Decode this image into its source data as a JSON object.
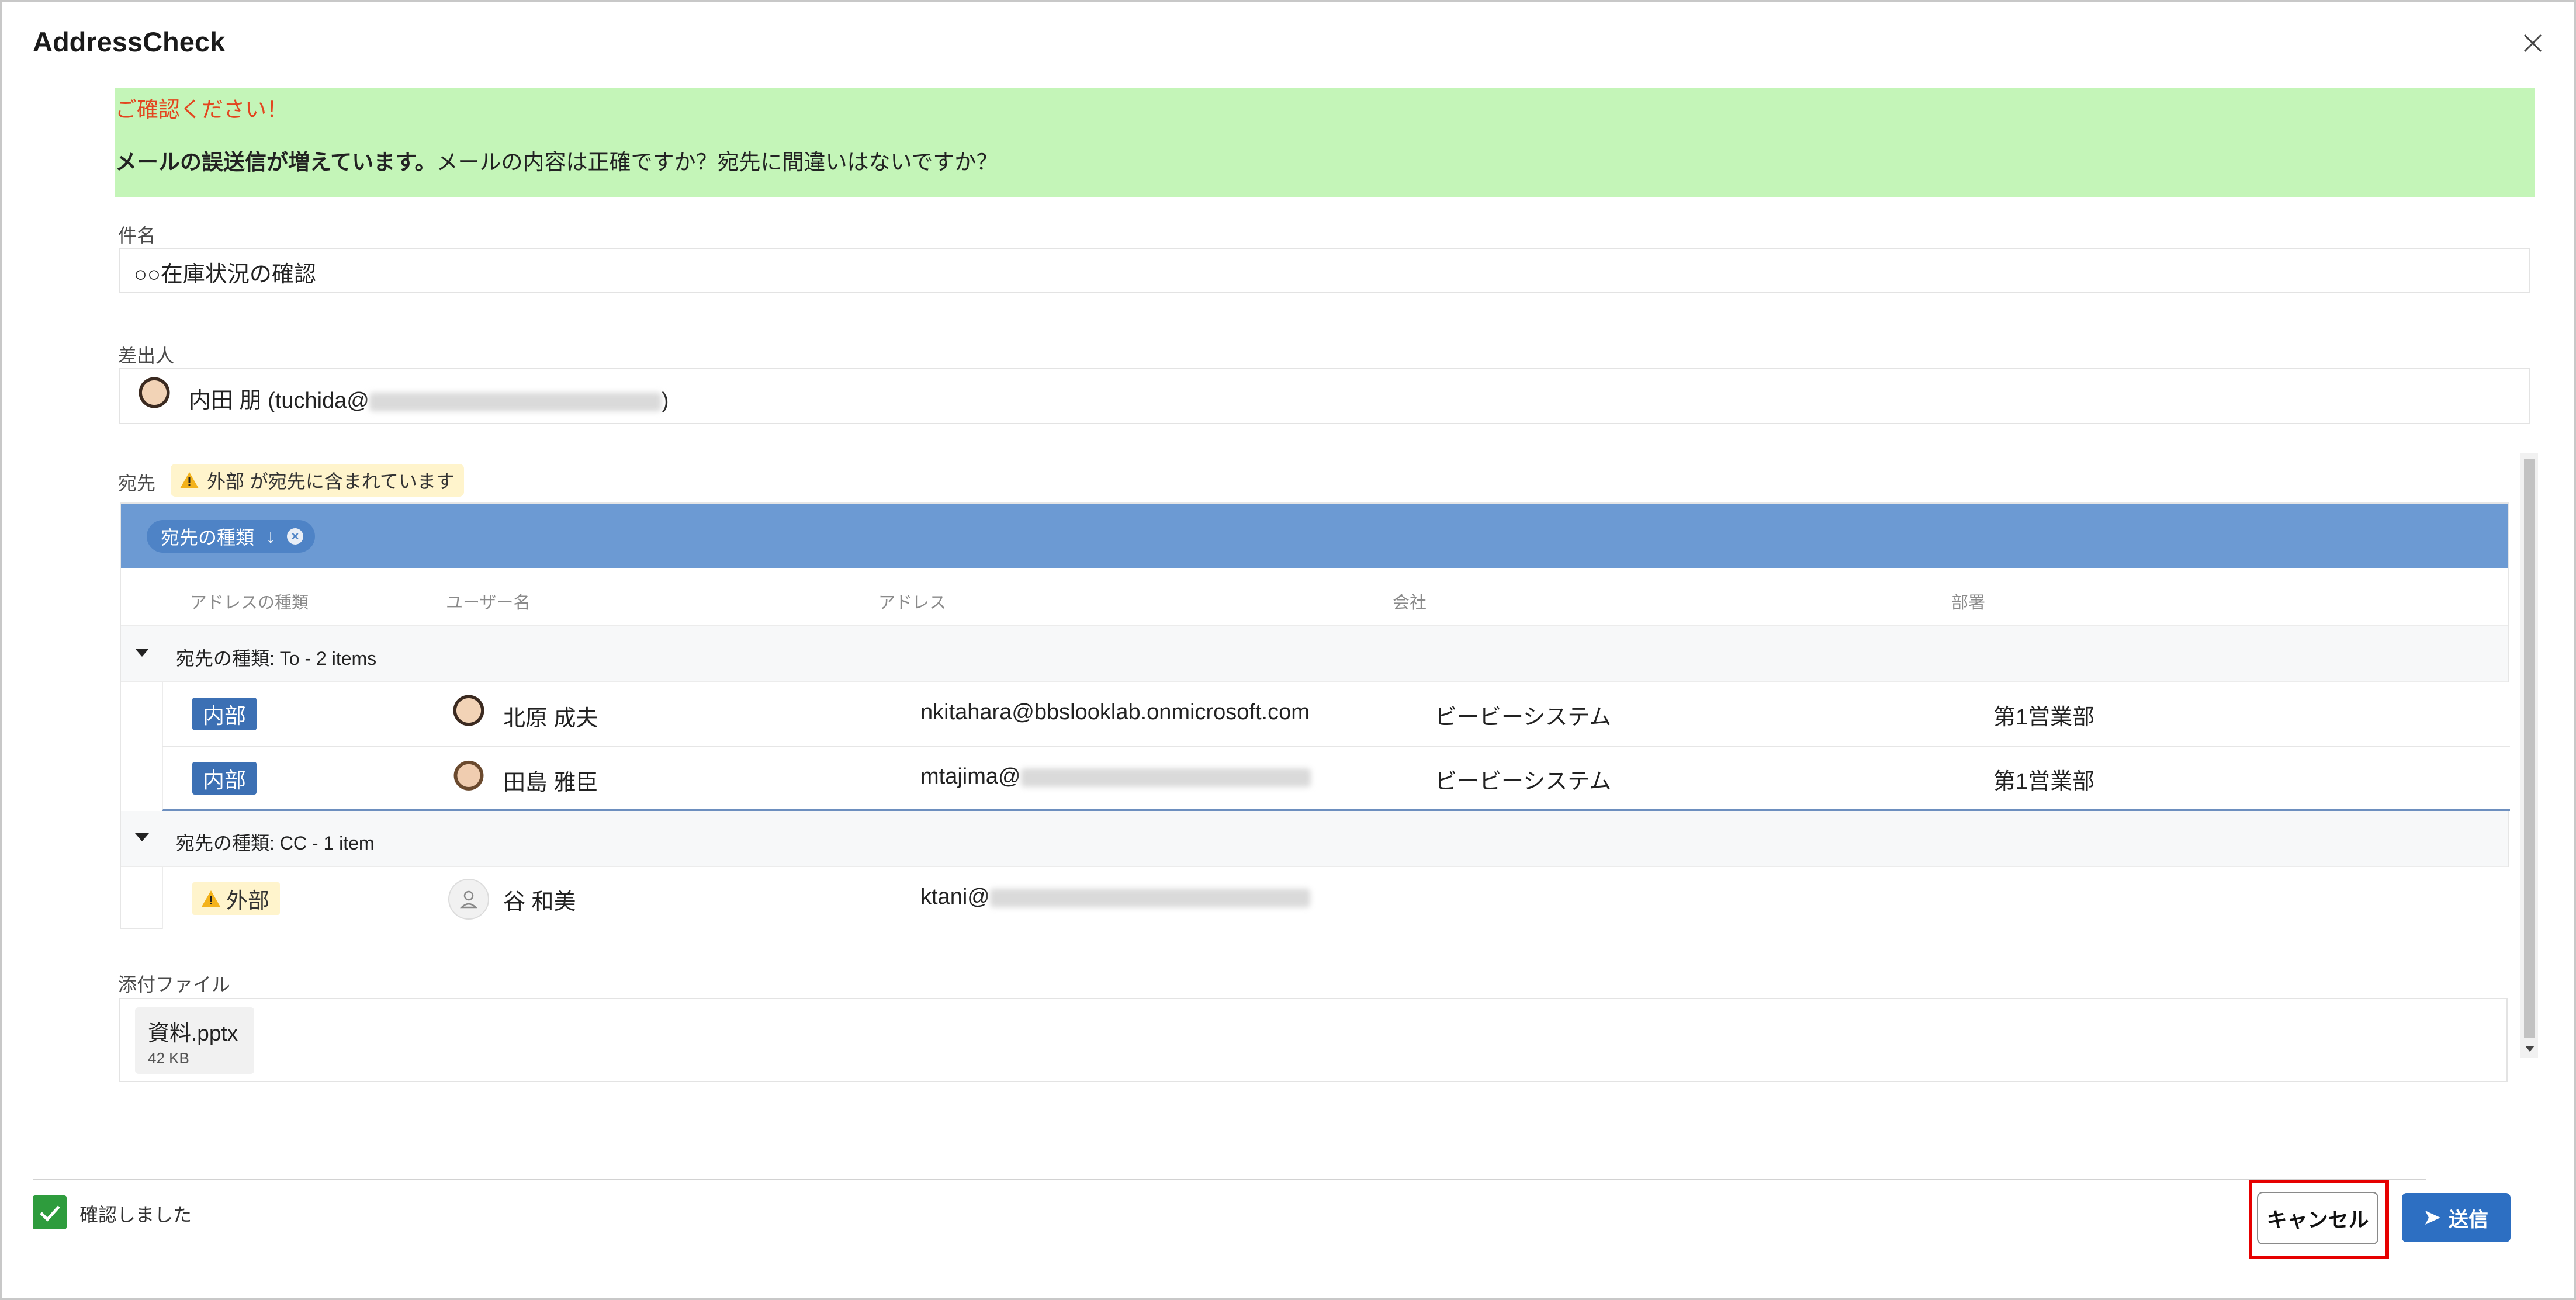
{
  "dialog": {
    "title": "AddressCheck",
    "close_icon": "close-icon"
  },
  "banner": {
    "heading": "ご確認ください！",
    "message_bold": "メールの誤送信が増えています。",
    "message_rest": "メールの内容は正確ですか？宛先に間違いはないですか？",
    "color": "#c4f5b8"
  },
  "subject": {
    "label": "件名",
    "value": "○○在庫状況の確認"
  },
  "sender": {
    "label": "差出人",
    "name": "内田 朋 (tuchida@",
    "email_domain_hidden": true,
    "closing_paren": ")"
  },
  "recipients": {
    "label": "宛先",
    "warning_chip": "外部 が宛先に含まれています",
    "group_chip": {
      "label": "宛先の種類",
      "sort_arrow": "↓"
    },
    "columns": [
      "アドレスの種類",
      "ユーザー名",
      "アドレス",
      "会社",
      "部署"
    ],
    "groups": [
      {
        "header": "宛先の種類: To - 2 items",
        "rows": [
          {
            "type": "内部",
            "name": "北原 成夫",
            "address": "nkitahara@bbslooklab.onmicrosoft.com",
            "company": "ビービーシステム",
            "dept": "第1営業部"
          },
          {
            "type": "内部",
            "name": "田島 雅臣",
            "address": "mtajima@",
            "company": "ビービーシステム",
            "dept": "第1営業部"
          }
        ]
      },
      {
        "header": "宛先の種類: CC - 1 item",
        "rows": [
          {
            "type": "外部",
            "name": "谷 和美",
            "address": "ktani@",
            "company": "",
            "dept": ""
          }
        ]
      }
    ]
  },
  "attachments": {
    "label": "添付ファイル",
    "files": [
      {
        "name": "資料.pptx",
        "size": "42 KB"
      }
    ]
  },
  "footer": {
    "confirm_label": "確認しました",
    "confirm_checked": true,
    "cancel_label": "キャンセル",
    "send_label": "送信",
    "accent": "#2d6fc2",
    "highlight": "#e60000"
  }
}
